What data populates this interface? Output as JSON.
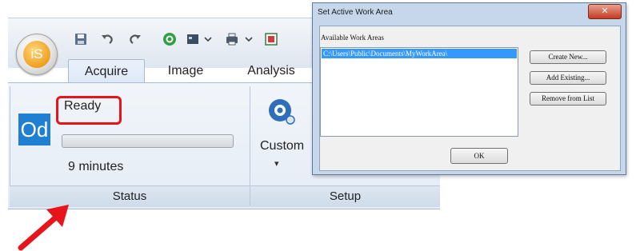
{
  "app": {
    "logo_text": "iS",
    "tabs": [
      {
        "label": "Acquire",
        "active": true
      },
      {
        "label": "Image",
        "active": false
      },
      {
        "label": "Analysis",
        "active": false
      }
    ],
    "quick_access_icons": [
      "save-icon",
      "undo-icon",
      "redo-icon",
      "record-icon",
      "window-icon",
      "dropdown-icon",
      "print-icon",
      "dropdown-icon",
      "layout-icon"
    ],
    "status_group": {
      "icon_text": "Od",
      "status": "Ready",
      "progress_percent": 0,
      "time_remaining": "9 minutes",
      "label": "Status"
    },
    "setup_group": {
      "button_label": "Custom",
      "label": "Setup"
    }
  },
  "dialog": {
    "title": "Set Active Work Area",
    "list_label": "Available Work Areas",
    "items": [
      "C:\\Users\\Public\\Documents\\MyWorkArea\\"
    ],
    "buttons": {
      "create_new": "Create New...",
      "add_existing": "Add Existing...",
      "remove": "Remove from List",
      "ok": "OK"
    }
  },
  "colors": {
    "highlight": "#e8141b",
    "arrow": "#e8141b",
    "selection": "#3399ff",
    "od_blue": "#1e7fd3"
  }
}
